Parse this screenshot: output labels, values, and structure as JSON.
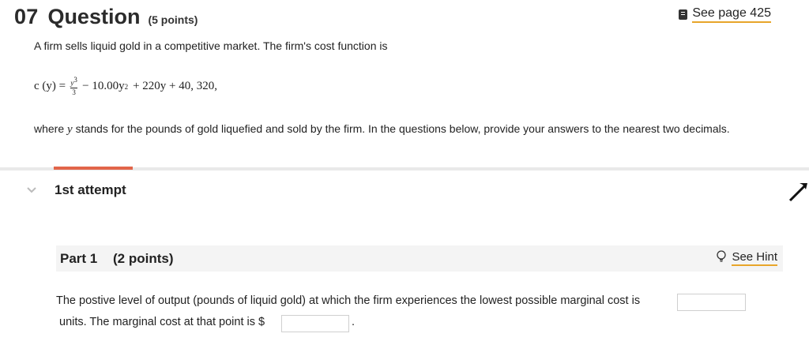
{
  "header": {
    "number": "07",
    "title": "Question",
    "points": "(5 points)",
    "see_page": "See page 425"
  },
  "problem": {
    "intro": "A firm sells liquid gold in a competitive market. The firm's cost function is",
    "formula": {
      "lhs": "c (y) =",
      "frac_num": "y",
      "frac_num_exp": "3",
      "frac_den": "3",
      "term2_a": "− 10.00y",
      "term2_exp": "2",
      "rest": "+ 220y + 40, 320,"
    },
    "where_prefix": "where ",
    "where_var": "y",
    "where_suffix": " stands for the pounds of gold liquefied and sold by the firm. In the questions below, provide your answers to the nearest two decimals."
  },
  "attempt": {
    "label": "1st attempt"
  },
  "part": {
    "title": "Part 1",
    "points": "(2 points)",
    "hint": "See Hint",
    "text_line1": "The postive level of output (pounds of liquid gold) at which the firm experiences the lowest possible marginal cost is",
    "text_line2": "units. The marginal cost at that point is $",
    "period": ".",
    "answer1_value": "",
    "answer2_value": ""
  },
  "colors": {
    "accent": "#e2654a",
    "link_underline": "#e8a52a"
  },
  "icons": [
    "book-icon",
    "chevron-down-icon",
    "lightbulb-icon",
    "cursor-arrow-icon"
  ]
}
